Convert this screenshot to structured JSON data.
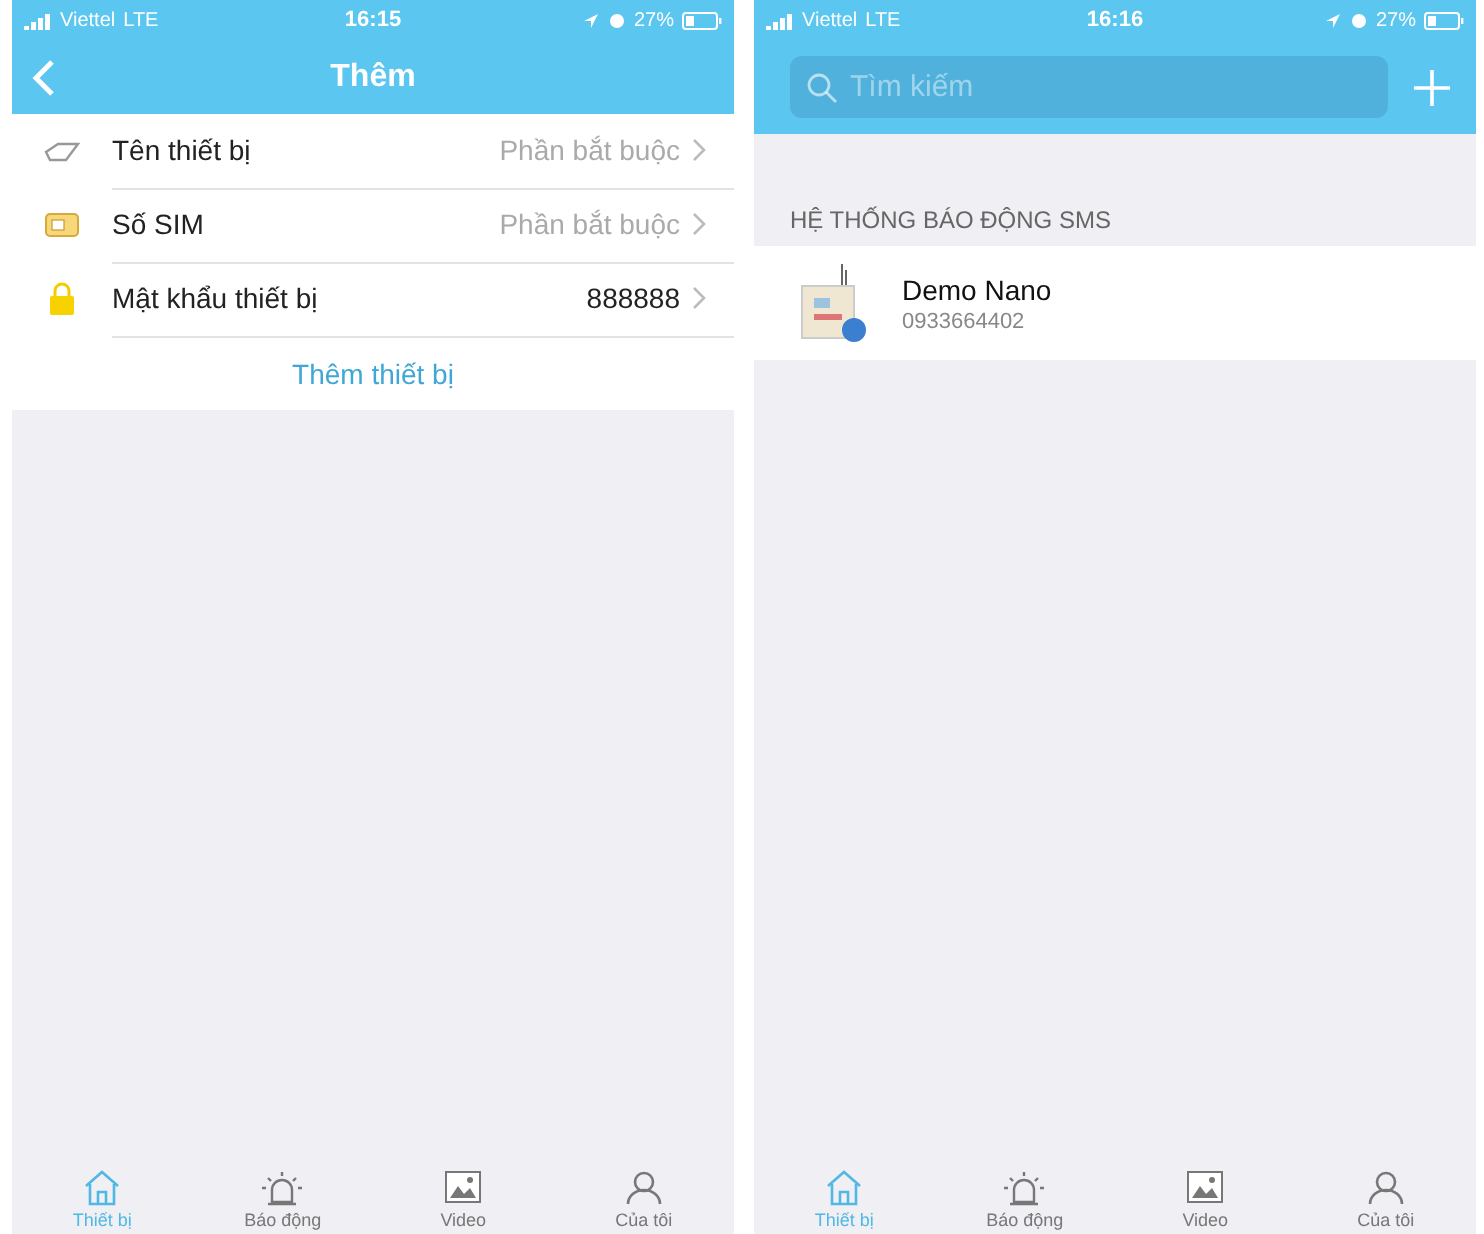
{
  "screens": [
    {
      "kind": "add",
      "status": {
        "carrier": "Viettel",
        "network": "LTE",
        "time": "16:15",
        "battery": "27%"
      },
      "title": "Thêm",
      "fields": [
        {
          "label": "Tên thiết bị",
          "placeholder": "Phần bắt buộc"
        },
        {
          "label": "Số SIM",
          "placeholder": "Phần bắt buộc"
        },
        {
          "label": "Mật khẩu thiết bị",
          "value": "888888"
        }
      ],
      "action": "Thêm thiết bị",
      "tabs": [
        {
          "label": "Thiết bị",
          "selected": true
        },
        {
          "label": "Báo động",
          "selected": false
        },
        {
          "label": "Video",
          "selected": false
        },
        {
          "label": "Của tôi",
          "selected": false
        }
      ]
    },
    {
      "kind": "list",
      "status": {
        "carrier": "Viettel",
        "network": "LTE",
        "time": "16:16",
        "battery": "27%"
      },
      "search": {
        "placeholder": "Tìm kiếm"
      },
      "section": "HỆ THỐNG BÁO ĐỘNG SMS",
      "devices": [
        {
          "name": "Demo Nano",
          "phone": "0933664402"
        }
      ],
      "tabs": [
        {
          "label": "Thiết bị",
          "selected": true
        },
        {
          "label": "Báo động",
          "selected": false
        },
        {
          "label": "Video",
          "selected": false
        },
        {
          "label": "Của tôi",
          "selected": false
        }
      ]
    }
  ]
}
